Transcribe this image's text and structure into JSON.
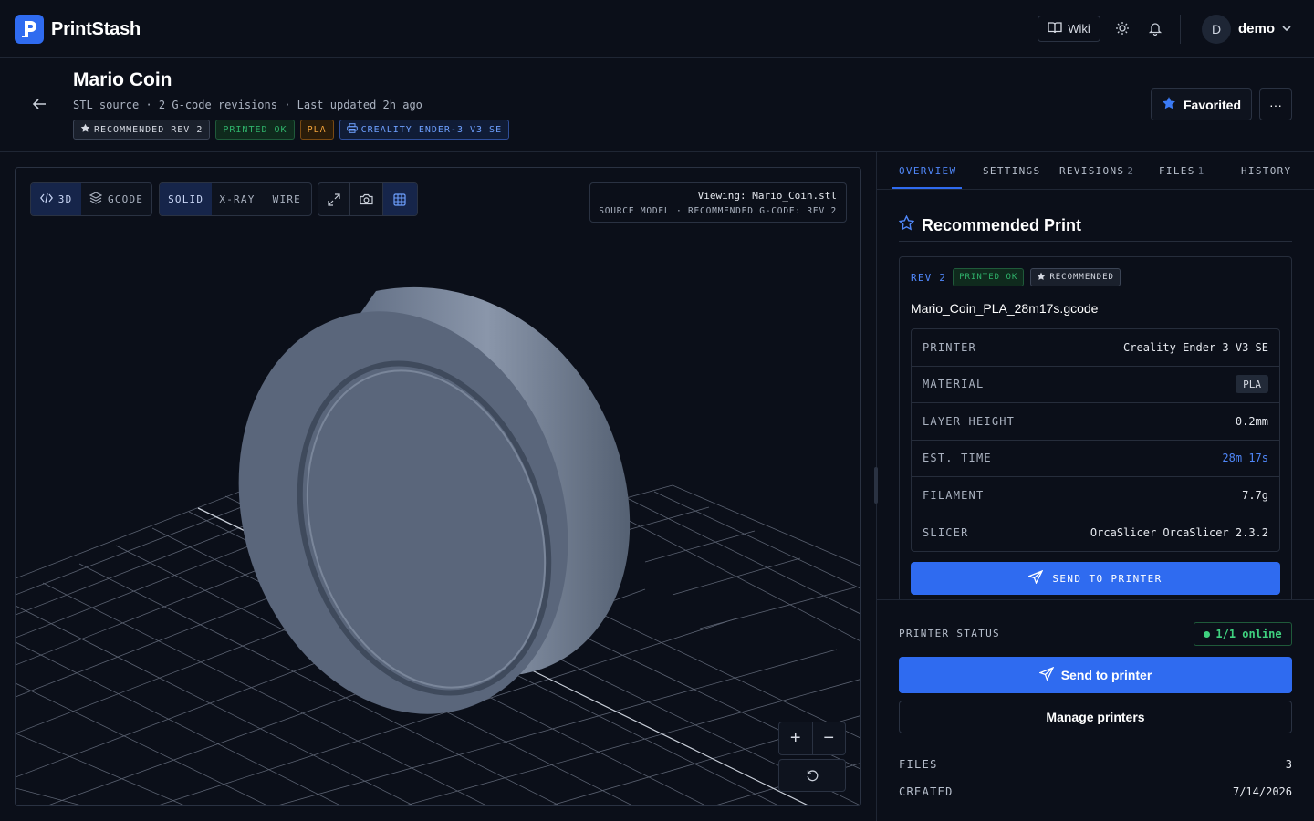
{
  "app": {
    "name": "PrintStash",
    "logo_letter": "P"
  },
  "topbar": {
    "wiki_label": "Wiki",
    "user_initial": "D",
    "user_name": "demo"
  },
  "header": {
    "title": "Mario Coin",
    "subtitle": "STL source · 2 G-code revisions · Last updated 2h ago",
    "chips": {
      "recommended": "RECOMMENDED REV 2",
      "printed": "PRINTED OK",
      "material": "PLA",
      "printer": "CREALITY ENDER-3 V3 SE"
    },
    "favorited_label": "Favorited",
    "more_label": "···"
  },
  "viewer": {
    "view_modes": [
      "3D",
      "GCODE"
    ],
    "active_view": "3D",
    "render_modes": [
      "SOLID",
      "X-RAY",
      "WIRE"
    ],
    "active_render": "SOLID",
    "viewing_line1": "Viewing: Mario_Coin.stl",
    "viewing_line2": "SOURCE MODEL · RECOMMENDED G-CODE: REV 2",
    "zoom_in": "+",
    "zoom_out": "−"
  },
  "tabs": [
    {
      "label": "OVERVIEW",
      "count": ""
    },
    {
      "label": "SETTINGS",
      "count": ""
    },
    {
      "label": "REVISIONS",
      "count": "2"
    },
    {
      "label": "FILES",
      "count": "1"
    },
    {
      "label": "HISTORY",
      "count": ""
    }
  ],
  "recommended": {
    "heading": "Recommended Print",
    "rev": "REV 2",
    "printed": "PRINTED OK",
    "recommended": "RECOMMENDED",
    "filename": "Mario_Coin_PLA_28m17s.gcode",
    "specs": {
      "printer_k": "PRINTER",
      "printer_v": "Creality Ender-3 V3 SE",
      "material_k": "MATERIAL",
      "material_v": "PLA",
      "layer_k": "LAYER HEIGHT",
      "layer_v": "0.2mm",
      "time_k": "EST. TIME",
      "time_v": "28m 17s",
      "filament_k": "FILAMENT",
      "filament_v": "7.7g",
      "slicer_k": "SLICER",
      "slicer_v": "OrcaSlicer OrcaSlicer 2.3.2"
    },
    "send_label": "SEND TO PRINTER"
  },
  "printer_status": {
    "label": "PRINTER STATUS",
    "online": "1/1 online",
    "send_label": "Send to printer",
    "manage_label": "Manage printers",
    "files_k": "FILES",
    "files_v": "3",
    "created_k": "CREATED",
    "created_v": "7/14/2026"
  },
  "colors": {
    "accent": "#2f6bf0",
    "success": "#3fd17f",
    "warning": "#f1a23a",
    "background": "#0b0f19"
  },
  "icons": [
    "logo-icon",
    "book-icon",
    "sun-icon",
    "bell-icon",
    "chevron-down-icon",
    "back-arrow-icon",
    "star-icon",
    "more-icon",
    "code-icon",
    "layers-icon",
    "expand-icon",
    "camera-icon",
    "grid-icon",
    "reset-icon",
    "send-icon",
    "printer-icon"
  ]
}
